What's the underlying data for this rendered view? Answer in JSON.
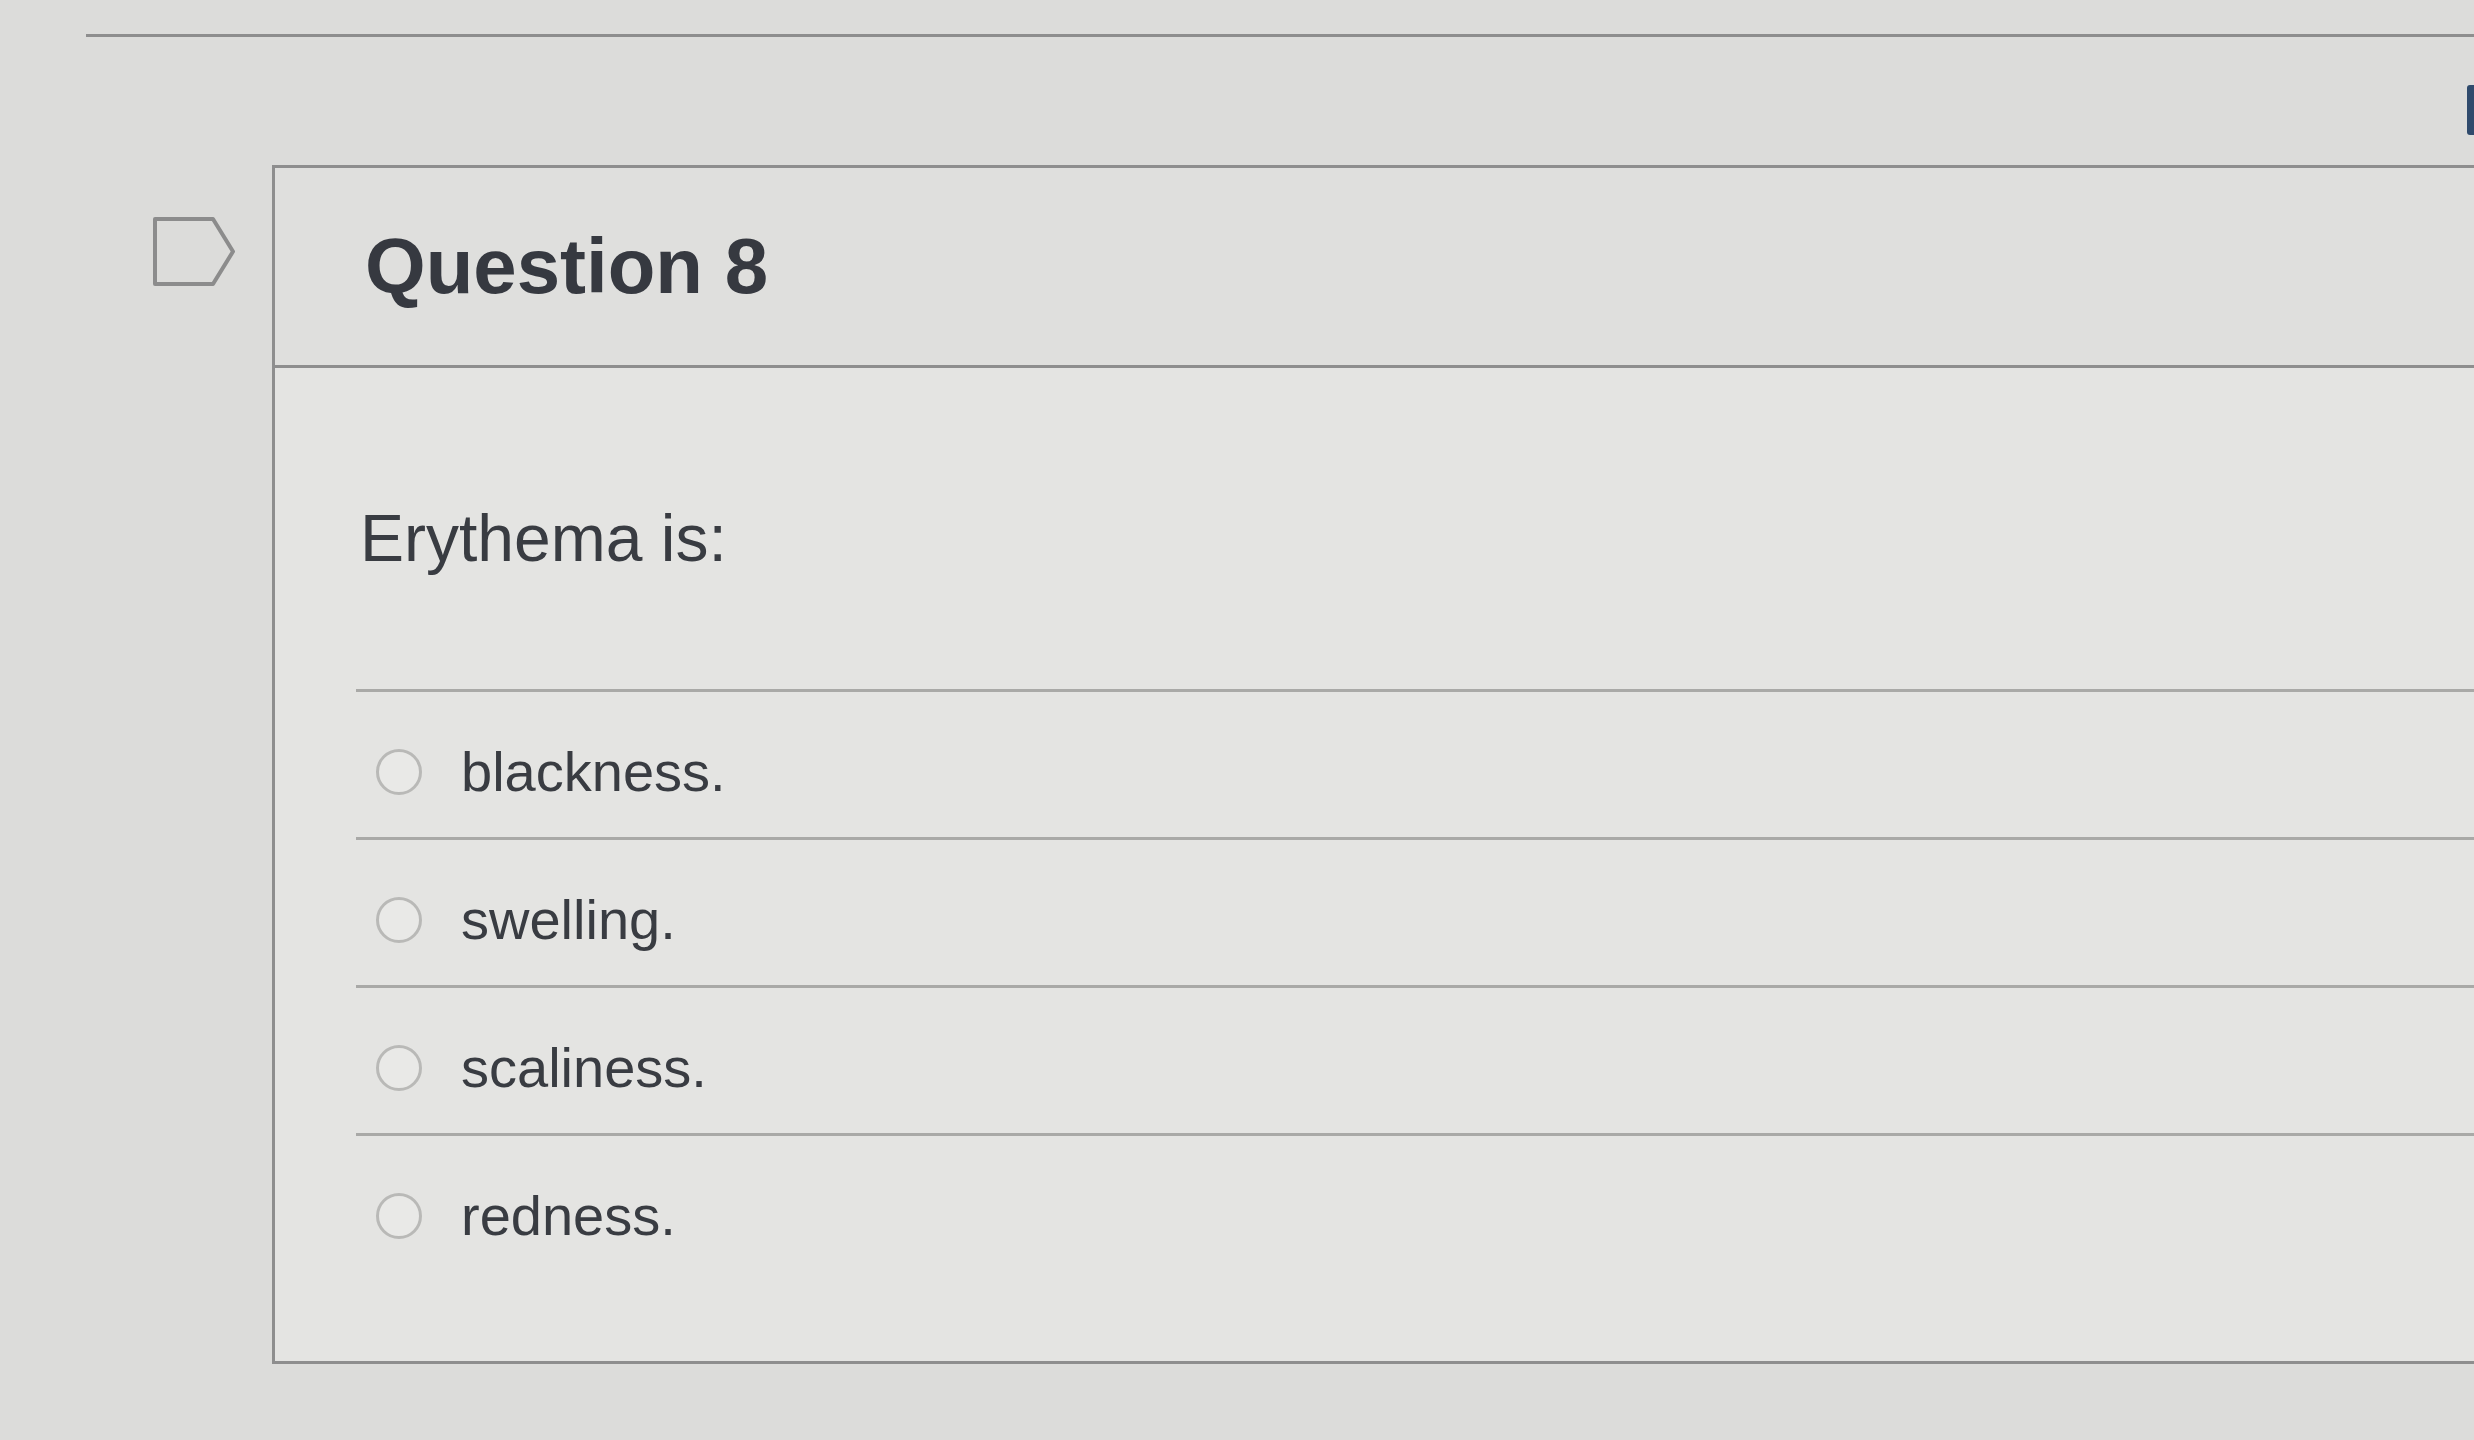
{
  "question": {
    "flagged": false,
    "title": "Question 8",
    "prompt": "Erythema is:",
    "options": [
      {
        "label": "blackness.",
        "selected": false
      },
      {
        "label": "swelling.",
        "selected": false
      },
      {
        "label": "scaliness.",
        "selected": false
      },
      {
        "label": "redness.",
        "selected": false
      }
    ]
  }
}
